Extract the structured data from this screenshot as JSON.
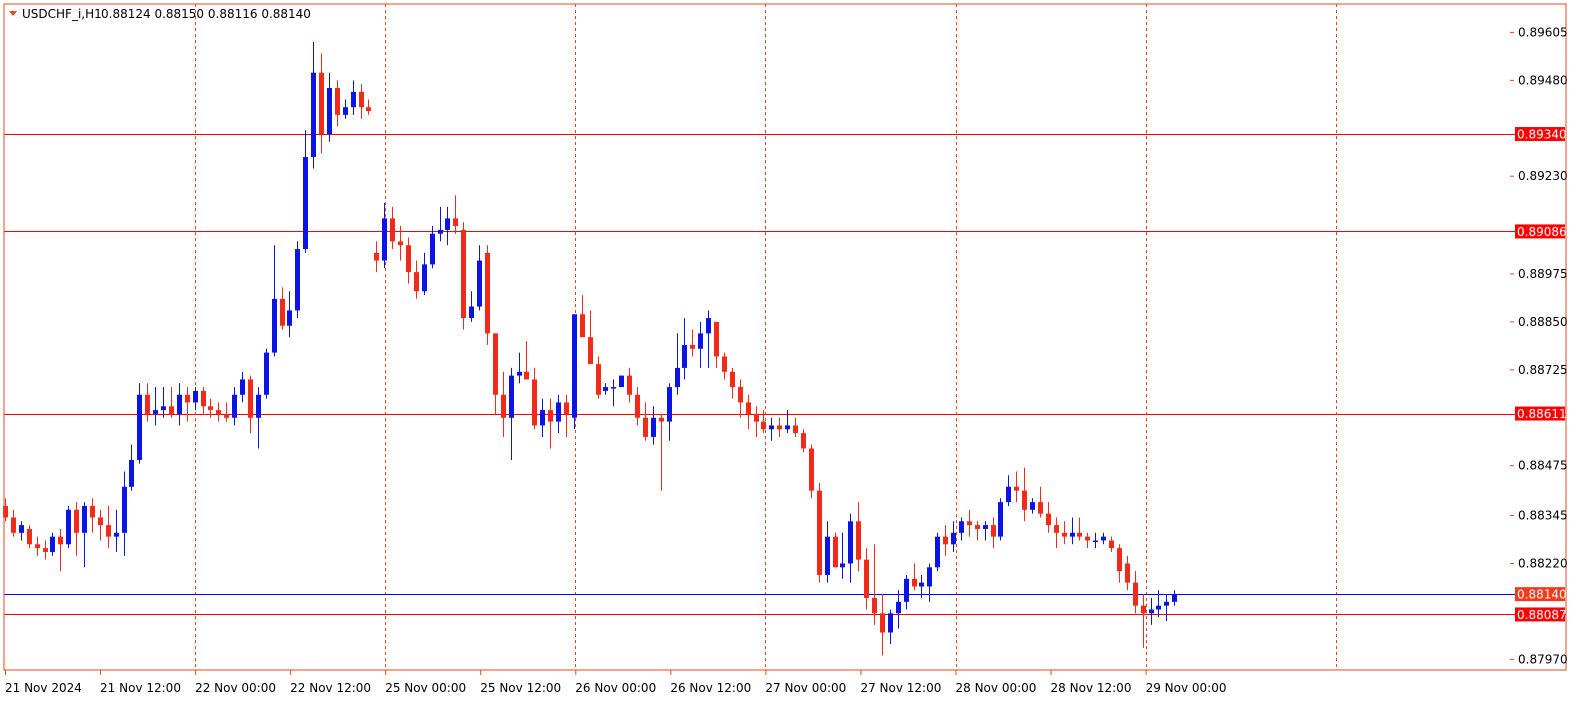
{
  "header": {
    "symbol": "USDCHF_i,H1",
    "ohlc": "0.88124 0.88150 0.88116 0.88140"
  },
  "colors": {
    "background": "#ffffff",
    "frame": "#e8471a",
    "grid": "#e8471a",
    "bull": "#0a14e6",
    "bear": "#f22a1a",
    "level_line": "#ff0000",
    "price_line": "#0000ff"
  },
  "chart_data": {
    "type": "candlestick",
    "title": "USDCHF_i,H1",
    "ylim": [
      0.8792,
      0.8967
    ],
    "y_ticks": [
      "0.89605",
      "0.89480",
      "0.89230",
      "0.88975",
      "0.88850",
      "0.88725",
      "0.88475",
      "0.88345",
      "0.88220",
      "0.87970"
    ],
    "x_ticks": [
      "21 Nov 2024",
      "21 Nov 12:00",
      "22 Nov 00:00",
      "22 Nov 12:00",
      "25 Nov 00:00",
      "25 Nov 12:00",
      "26 Nov 00:00",
      "26 Nov 12:00",
      "27 Nov 00:00",
      "27 Nov 12:00",
      "28 Nov 00:00",
      "28 Nov 12:00",
      "29 Nov 00:00"
    ],
    "grid": true,
    "horizontal_levels": [
      {
        "value": 0.8934,
        "label": "0.89340"
      },
      {
        "value": 0.89086,
        "label": "0.89086"
      },
      {
        "value": 0.88611,
        "label": "0.88611"
      },
      {
        "value": 0.88087,
        "label": "0.88087"
      }
    ],
    "current_price": {
      "value": 0.8814,
      "label": "0.88140"
    },
    "candles": [
      [
        0.8837,
        0.8839,
        0.8833,
        0.8834
      ],
      [
        0.8834,
        0.8836,
        0.8829,
        0.883
      ],
      [
        0.883,
        0.8833,
        0.8828,
        0.8832
      ],
      [
        0.8831,
        0.8832,
        0.8826,
        0.8827
      ],
      [
        0.8827,
        0.8829,
        0.8824,
        0.8826
      ],
      [
        0.8826,
        0.8828,
        0.8823,
        0.8825
      ],
      [
        0.8825,
        0.883,
        0.8824,
        0.8829
      ],
      [
        0.8829,
        0.8831,
        0.882,
        0.8827
      ],
      [
        0.8827,
        0.8837,
        0.8826,
        0.8836
      ],
      [
        0.8836,
        0.8838,
        0.8824,
        0.883
      ],
      [
        0.883,
        0.8838,
        0.8821,
        0.8837
      ],
      [
        0.8837,
        0.8839,
        0.883,
        0.8834
      ],
      [
        0.8834,
        0.8836,
        0.8828,
        0.8832
      ],
      [
        0.8832,
        0.8837,
        0.8826,
        0.8829
      ],
      [
        0.8829,
        0.8836,
        0.8825,
        0.883
      ],
      [
        0.883,
        0.8846,
        0.8824,
        0.8842
      ],
      [
        0.8842,
        0.8853,
        0.8841,
        0.8849
      ],
      [
        0.8849,
        0.8869,
        0.8848,
        0.8866
      ],
      [
        0.8866,
        0.8869,
        0.8859,
        0.8861
      ],
      [
        0.8861,
        0.8868,
        0.8858,
        0.8862
      ],
      [
        0.8862,
        0.8868,
        0.886,
        0.8863
      ],
      [
        0.8863,
        0.8868,
        0.886,
        0.8861
      ],
      [
        0.8861,
        0.8869,
        0.8858,
        0.8866
      ],
      [
        0.8866,
        0.8868,
        0.8859,
        0.8864
      ],
      [
        0.8864,
        0.8868,
        0.8862,
        0.8867
      ],
      [
        0.8867,
        0.8868,
        0.8861,
        0.8863
      ],
      [
        0.8863,
        0.8865,
        0.886,
        0.8862
      ],
      [
        0.8862,
        0.8864,
        0.8859,
        0.8861
      ],
      [
        0.8861,
        0.8864,
        0.8859,
        0.886
      ],
      [
        0.886,
        0.8868,
        0.8858,
        0.8866
      ],
      [
        0.8866,
        0.8872,
        0.8864,
        0.887
      ],
      [
        0.887,
        0.8871,
        0.8856,
        0.886
      ],
      [
        0.886,
        0.8868,
        0.8852,
        0.8866
      ],
      [
        0.8866,
        0.8878,
        0.8865,
        0.8877
      ],
      [
        0.8877,
        0.8905,
        0.8876,
        0.8891
      ],
      [
        0.8891,
        0.8894,
        0.8883,
        0.8884
      ],
      [
        0.8884,
        0.8893,
        0.8881,
        0.8888
      ],
      [
        0.8888,
        0.8906,
        0.8886,
        0.8904
      ],
      [
        0.8904,
        0.8935,
        0.8903,
        0.8928
      ],
      [
        0.8928,
        0.8958,
        0.8925,
        0.895
      ],
      [
        0.895,
        0.8955,
        0.8929,
        0.8934
      ],
      [
        0.8934,
        0.895,
        0.8932,
        0.8946
      ],
      [
        0.8946,
        0.8948,
        0.8936,
        0.8939
      ],
      [
        0.8939,
        0.8943,
        0.8938,
        0.8941
      ],
      [
        0.8941,
        0.8948,
        0.8939,
        0.8945
      ],
      [
        0.8945,
        0.8947,
        0.8938,
        0.8941
      ],
      [
        0.8941,
        0.8943,
        0.8939,
        0.894
      ],
      [
        0.8903,
        0.8906,
        0.8898,
        0.8901
      ],
      [
        0.8901,
        0.8916,
        0.8899,
        0.8912
      ],
      [
        0.8912,
        0.8915,
        0.8904,
        0.8906
      ],
      [
        0.8906,
        0.891,
        0.8901,
        0.8905
      ],
      [
        0.8905,
        0.8907,
        0.8895,
        0.8898
      ],
      [
        0.8898,
        0.8901,
        0.8891,
        0.8893
      ],
      [
        0.8893,
        0.8903,
        0.8892,
        0.89
      ],
      [
        0.89,
        0.891,
        0.8899,
        0.8908
      ],
      [
        0.8908,
        0.8915,
        0.8906,
        0.8909
      ],
      [
        0.8909,
        0.8915,
        0.8905,
        0.8912
      ],
      [
        0.8912,
        0.8918,
        0.8908,
        0.891
      ],
      [
        0.8909,
        0.8911,
        0.8883,
        0.8886
      ],
      [
        0.8886,
        0.8893,
        0.8885,
        0.8889
      ],
      [
        0.8889,
        0.8905,
        0.8888,
        0.8901
      ],
      [
        0.8903,
        0.8905,
        0.8879,
        0.8882
      ],
      [
        0.8882,
        0.8882,
        0.8861,
        0.8866
      ],
      [
        0.8866,
        0.8872,
        0.8855,
        0.886
      ],
      [
        0.886,
        0.8873,
        0.8849,
        0.8871
      ],
      [
        0.8871,
        0.8877,
        0.8869,
        0.8872
      ],
      [
        0.8872,
        0.888,
        0.887,
        0.887
      ],
      [
        0.887,
        0.8873,
        0.8857,
        0.8858
      ],
      [
        0.8858,
        0.8865,
        0.8855,
        0.8862
      ],
      [
        0.8862,
        0.8865,
        0.8852,
        0.8859
      ],
      [
        0.8859,
        0.8866,
        0.8856,
        0.8864
      ],
      [
        0.8864,
        0.8866,
        0.8855,
        0.8861
      ],
      [
        0.886,
        0.8886,
        0.8857,
        0.8887
      ],
      [
        0.8887,
        0.8892,
        0.8883,
        0.8881
      ],
      [
        0.8881,
        0.8888,
        0.8879,
        0.8874
      ],
      [
        0.8874,
        0.8876,
        0.8865,
        0.8866
      ],
      [
        0.8867,
        0.8869,
        0.8866,
        0.8868
      ],
      [
        0.8868,
        0.887,
        0.8863,
        0.8868
      ],
      [
        0.8868,
        0.8871,
        0.8869,
        0.8871
      ],
      [
        0.8871,
        0.8873,
        0.8864,
        0.8866
      ],
      [
        0.8866,
        0.8868,
        0.8858,
        0.886
      ],
      [
        0.886,
        0.8864,
        0.8854,
        0.8855
      ],
      [
        0.8855,
        0.8863,
        0.8853,
        0.886
      ],
      [
        0.886,
        0.8861,
        0.8841,
        0.8859
      ],
      [
        0.8859,
        0.8869,
        0.8854,
        0.8868
      ],
      [
        0.8868,
        0.8882,
        0.8866,
        0.8873
      ],
      [
        0.8873,
        0.8886,
        0.887,
        0.8879
      ],
      [
        0.8879,
        0.8883,
        0.8876,
        0.8878
      ],
      [
        0.8878,
        0.8885,
        0.8873,
        0.8882
      ],
      [
        0.8882,
        0.8888,
        0.8873,
        0.8886
      ],
      [
        0.8885,
        0.8885,
        0.8873,
        0.8876
      ],
      [
        0.8876,
        0.8877,
        0.887,
        0.8872
      ],
      [
        0.8872,
        0.8873,
        0.8865,
        0.8868
      ],
      [
        0.8868,
        0.887,
        0.886,
        0.8864
      ],
      [
        0.8864,
        0.8866,
        0.8857,
        0.8861
      ],
      [
        0.8861,
        0.8863,
        0.8855,
        0.8859
      ],
      [
        0.8859,
        0.8862,
        0.8856,
        0.8857
      ],
      [
        0.8857,
        0.886,
        0.8854,
        0.8858
      ],
      [
        0.8858,
        0.886,
        0.8855,
        0.8857
      ],
      [
        0.8857,
        0.8862,
        0.8856,
        0.8858
      ],
      [
        0.8858,
        0.886,
        0.8855,
        0.8856
      ],
      [
        0.8856,
        0.8857,
        0.8851,
        0.8852
      ],
      [
        0.8852,
        0.8853,
        0.8839,
        0.8841
      ],
      [
        0.8841,
        0.8843,
        0.8817,
        0.8819
      ],
      [
        0.8819,
        0.8833,
        0.8817,
        0.8829
      ],
      [
        0.8829,
        0.883,
        0.8821,
        0.8821
      ],
      [
        0.8821,
        0.883,
        0.8818,
        0.8822
      ],
      [
        0.8822,
        0.8835,
        0.8817,
        0.8833
      ],
      [
        0.8833,
        0.8838,
        0.882,
        0.8823
      ],
      [
        0.8823,
        0.8826,
        0.881,
        0.8813
      ],
      [
        0.8813,
        0.8827,
        0.8806,
        0.8809
      ],
      [
        0.8809,
        0.8814,
        0.8798,
        0.8804
      ],
      [
        0.8804,
        0.881,
        0.8801,
        0.8809
      ],
      [
        0.8809,
        0.8815,
        0.8805,
        0.8812
      ],
      [
        0.8812,
        0.8819,
        0.881,
        0.8818
      ],
      [
        0.8818,
        0.8822,
        0.8815,
        0.8816
      ],
      [
        0.8816,
        0.8819,
        0.8813,
        0.8817
      ],
      [
        0.8816,
        0.8822,
        0.8812,
        0.8821
      ],
      [
        0.8821,
        0.883,
        0.882,
        0.8829
      ],
      [
        0.8829,
        0.8832,
        0.8824,
        0.8827
      ],
      [
        0.8827,
        0.8833,
        0.8825,
        0.883
      ],
      [
        0.883,
        0.8834,
        0.8828,
        0.8833
      ],
      [
        0.8833,
        0.8836,
        0.8829,
        0.8832
      ],
      [
        0.8832,
        0.8833,
        0.8828,
        0.8831
      ],
      [
        0.8831,
        0.8833,
        0.8828,
        0.8832
      ],
      [
        0.8832,
        0.8834,
        0.8826,
        0.8829
      ],
      [
        0.8829,
        0.8839,
        0.8828,
        0.8838
      ],
      [
        0.8838,
        0.8845,
        0.8837,
        0.8842
      ],
      [
        0.8842,
        0.8846,
        0.8838,
        0.8841
      ],
      [
        0.8841,
        0.8847,
        0.8833,
        0.8836
      ],
      [
        0.8836,
        0.8839,
        0.8835,
        0.8838
      ],
      [
        0.8838,
        0.8842,
        0.8834,
        0.8835
      ],
      [
        0.8835,
        0.8838,
        0.883,
        0.8832
      ],
      [
        0.8832,
        0.8834,
        0.8826,
        0.883
      ],
      [
        0.883,
        0.8833,
        0.8827,
        0.8829
      ],
      [
        0.8829,
        0.8834,
        0.8827,
        0.883
      ],
      [
        0.883,
        0.8834,
        0.8828,
        0.8829
      ],
      [
        0.8829,
        0.883,
        0.8826,
        0.8828
      ],
      [
        0.8828,
        0.883,
        0.8826,
        0.8828
      ],
      [
        0.8828,
        0.883,
        0.8827,
        0.8829
      ],
      [
        0.8828,
        0.8829,
        0.8825,
        0.8826
      ],
      [
        0.8826,
        0.8827,
        0.8817,
        0.882
      ],
      [
        0.8822,
        0.8824,
        0.8815,
        0.8817
      ],
      [
        0.8817,
        0.882,
        0.8809,
        0.8811
      ],
      [
        0.8811,
        0.8814,
        0.88,
        0.8809
      ],
      [
        0.8809,
        0.8813,
        0.8806,
        0.881
      ],
      [
        0.881,
        0.8815,
        0.8808,
        0.8811
      ],
      [
        0.8811,
        0.8814,
        0.8807,
        0.8812
      ],
      [
        0.8812,
        0.8815,
        0.8811,
        0.8814
      ]
    ]
  }
}
